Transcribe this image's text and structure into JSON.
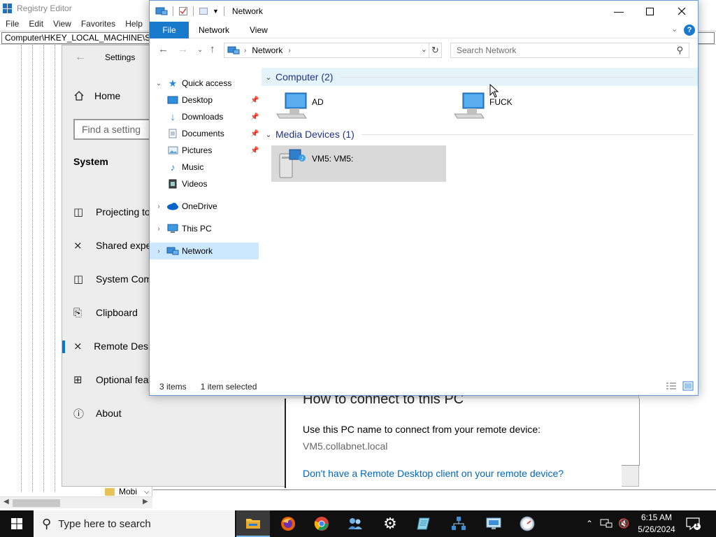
{
  "registry_editor": {
    "title": "Registry Editor",
    "menu": [
      "File",
      "Edit",
      "View",
      "Favorites",
      "Help"
    ],
    "address": "Computer\\HKEY_LOCAL_MACHINE\\SO",
    "tree_visible_item": "Mobi",
    "accent": "#1f6fc5"
  },
  "settings": {
    "title": "Settings",
    "home_label": "Home",
    "search_placeholder": "Find a setting",
    "section": "System",
    "nav": [
      {
        "label": "Projecting to",
        "icon": "projector-icon"
      },
      {
        "label": "Shared expe",
        "icon": "shared-experiences-icon"
      },
      {
        "label": "System Com",
        "icon": "system-components-icon"
      },
      {
        "label": "Clipboard",
        "icon": "clipboard-icon"
      },
      {
        "label": "Remote Desk",
        "icon": "remote-desktop-icon",
        "active": true
      },
      {
        "label": "Optional feat",
        "icon": "optional-features-icon"
      },
      {
        "label": "About",
        "icon": "info-icon"
      }
    ],
    "main": {
      "heading_cropped": "How to connect to this PC",
      "description": "Use this PC name to connect from your remote device:",
      "pc_name": "VM5.collabnet.local",
      "link": "Don't have a Remote Desktop client on your remote device?"
    },
    "accent": "#0078d7"
  },
  "explorer": {
    "title": "Network",
    "ribbon_tabs": {
      "file": "File",
      "network": "Network",
      "view": "View"
    },
    "help_symbol": "?",
    "address_crumb": "Network",
    "search_placeholder": "Search Network",
    "nav_pane": {
      "quick_access": "Quick access",
      "pinned": [
        {
          "label": "Desktop",
          "pinned": true
        },
        {
          "label": "Downloads",
          "pinned": true
        },
        {
          "label": "Documents",
          "pinned": true
        },
        {
          "label": "Pictures",
          "pinned": true
        },
        {
          "label": "Music",
          "pinned": false
        },
        {
          "label": "Videos",
          "pinned": false
        }
      ],
      "onedrive": "OneDrive",
      "this_pc": "This PC",
      "network": "Network"
    },
    "groups": {
      "computer": {
        "header": "Computer (2)",
        "items": [
          "AD",
          "FUCK"
        ]
      },
      "media": {
        "header": "Media Devices (1)",
        "items": [
          "VM5: VM5:"
        ]
      }
    },
    "status": {
      "item_count": "3 items",
      "selection": "1 item selected"
    },
    "colors": {
      "file_tab": "#1979ca",
      "group_header": "#1e3287",
      "selection": "#cce8ff"
    }
  },
  "taskbar": {
    "search_placeholder": "Type here to search",
    "apps": [
      "file-explorer-icon",
      "firefox-icon",
      "chrome-icon",
      "users-icon",
      "settings-gear-icon",
      "notepad-icon",
      "network-tool-icon",
      "remote-desktop-app-icon",
      "performance-monitor-icon"
    ],
    "time": "6:15 AM",
    "date": "5/26/2024",
    "notification_count": "1"
  }
}
